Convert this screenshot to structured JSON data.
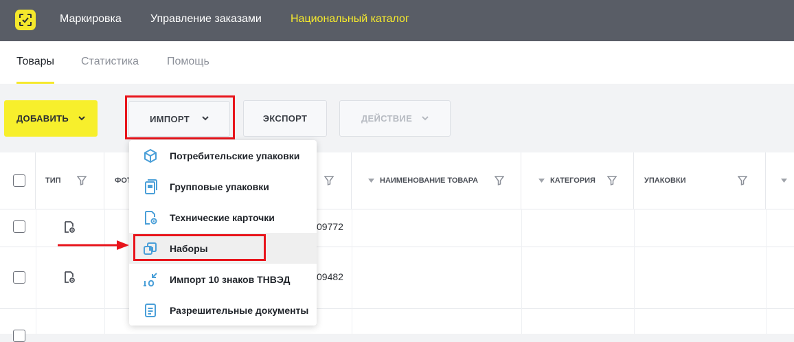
{
  "topbar": {
    "nav": [
      {
        "label": "Маркировка"
      },
      {
        "label": "Управление заказами"
      },
      {
        "label": "Национальный каталог"
      }
    ],
    "active_color": "#f6ea2d"
  },
  "tabs": [
    {
      "label": "Товары"
    },
    {
      "label": "Статистика"
    },
    {
      "label": "Помощь"
    }
  ],
  "toolbar": {
    "add_label": "ДОБАВИТЬ",
    "import_label": "ИМПОРТ",
    "export_label": "ЭКСПОРТ",
    "action_label": "ДЕЙСТВИЕ"
  },
  "table": {
    "columns": {
      "type": "ТИП",
      "photo": "ФОТ",
      "name": "НАИМЕНОВАНИЕ ТОВАРА",
      "category": "КАТЕГОРИЯ",
      "packages": "УПАКОВКИ"
    },
    "rows": [
      {
        "code_fragment": "09772"
      },
      {
        "code_fragment": "09482"
      }
    ]
  },
  "dropdown": {
    "items": [
      {
        "label": "Потребительские упаковки",
        "icon": "cube-icon"
      },
      {
        "label": "Групповые упаковки",
        "icon": "group-package-icon"
      },
      {
        "label": "Технические карточки",
        "icon": "tech-card-icon"
      },
      {
        "label": "Наборы",
        "icon": "sets-icon"
      },
      {
        "label": "Импорт 10 знаков ТНВЭД",
        "icon": "import-10-icon"
      },
      {
        "label": "Разрешительные документы",
        "icon": "document-icon"
      }
    ]
  },
  "colors": {
    "brand_yellow": "#f5e82c",
    "topbar": "#595d66",
    "highlight_red": "#e8141b",
    "icon_blue": "#4a9fd8"
  }
}
